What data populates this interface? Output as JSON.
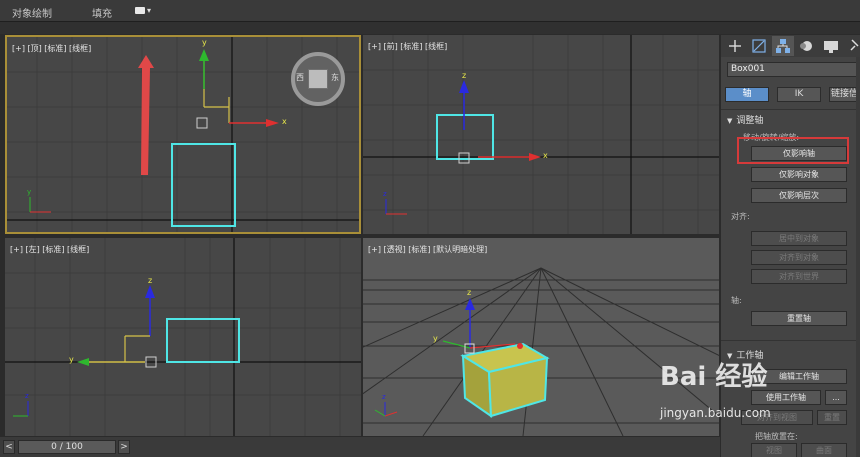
{
  "menu": {
    "items": [
      "对象绘制",
      "填充"
    ]
  },
  "viewports": {
    "top": "[+] [顶] [标准] [线框]",
    "front": "[+] [前] [标准] [线框]",
    "left": "[+] [左] [标准] [线框]",
    "perspective": "[+] [透视] [标准] [默认明暗处理]"
  },
  "viewcube": {
    "left_letter": "西",
    "right_letter": "东"
  },
  "axes": {
    "x": "x",
    "y": "y",
    "z": "z"
  },
  "timeline": {
    "frame": "0 / 100",
    "prev": "<",
    "next": ">"
  },
  "panel": {
    "tabs": [
      "create-icon",
      "modify-icon",
      "hierarchy-icon",
      "motion-icon",
      "display-icon",
      "utilities-icon"
    ],
    "object_name": "Box001",
    "modes": [
      "轴",
      "IK",
      "链接信"
    ],
    "adjust_pivot": {
      "title": "调整轴",
      "group_move": "移动/旋转/缩放:",
      "affect_pivot_only": "仅影响轴",
      "affect_object_only": "仅影响对象",
      "affect_hierarchy_only": "仅影响层次",
      "group_align": "对齐:",
      "center_to_object": "居中到对象",
      "align_to_object": "对齐到对象",
      "align_to_world": "对齐到世界",
      "group_pivot": "轴:",
      "reset_pivot": "重置轴"
    },
    "working_pivot": {
      "title": "工作轴",
      "edit_working_pivot": "编辑工作轴",
      "use_working_pivot": "使用工作轴",
      "more": "...",
      "align_to_view": "对齐到视图",
      "reset": "重置",
      "place_pivot_to": "把轴放置在:",
      "view": "视图",
      "surface": "曲面"
    }
  },
  "watermark": {
    "brand": "Bai 经验",
    "url": "jingyan.baidu.com"
  },
  "colors": {
    "accent_blue": "#5b8ec9",
    "highlight_red": "#d63a3a",
    "selected_cyan": "#4fe6e6",
    "viewport_border_active": "#a98f38"
  }
}
